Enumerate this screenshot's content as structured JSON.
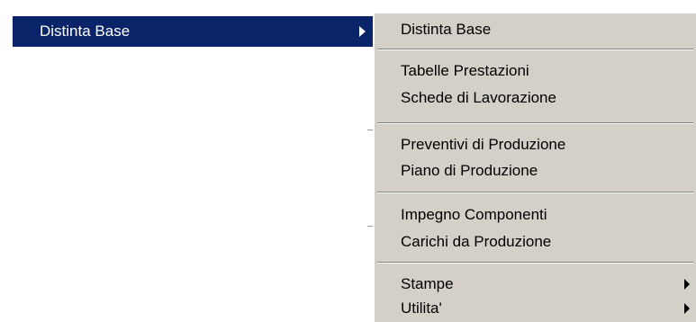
{
  "parent_menu": {
    "item_label": "Distinta Base"
  },
  "submenu": {
    "groups": [
      [
        "Distinta Base"
      ],
      [
        "Tabelle Prestazioni",
        "Schede di Lavorazione"
      ],
      [
        "Preventivi di Produzione",
        "Piano di Produzione"
      ],
      [
        "Impegno Componenti",
        "Carichi da Produzione"
      ],
      [
        "Stampe",
        "Utilita'"
      ]
    ],
    "items": {
      "distinta_base": "Distinta Base",
      "tabelle_prestazioni": "Tabelle Prestazioni",
      "schede_lavorazione": "Schede di Lavorazione",
      "preventivi_produzione": "Preventivi di Produzione",
      "piano_produzione": "Piano di Produzione",
      "impegno_componenti": "Impegno Componenti",
      "carichi_produzione": "Carichi da Produzione",
      "stampe": "Stampe",
      "utilita": "Utilita'"
    }
  },
  "colors": {
    "menu_background": "#d4d0c8",
    "highlight": "#0a246a",
    "highlight_text": "#ffffff",
    "separator_dark": "#808080",
    "separator_light": "#ffffff"
  },
  "icons": [
    "submenu-arrow-icon"
  ]
}
